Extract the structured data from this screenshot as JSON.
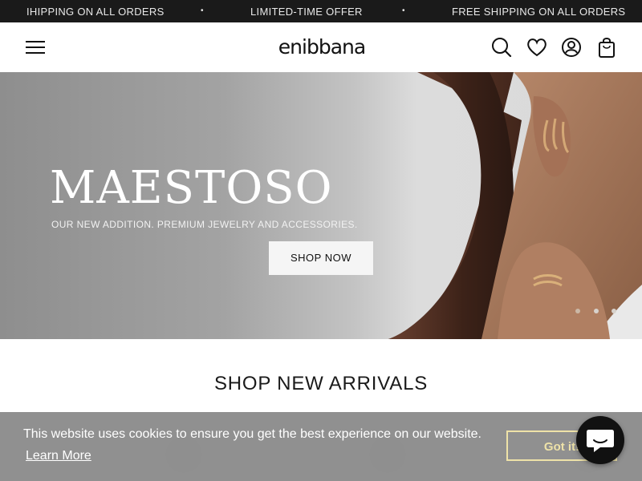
{
  "announcement": {
    "items": [
      "IHIPPING ON ALL ORDERS",
      "LIMITED-TIME OFFER",
      "FREE SHIPPING ON ALL ORDERS"
    ],
    "separator": "•"
  },
  "header": {
    "logo": "enibbana",
    "icons": [
      "menu-icon",
      "search-icon",
      "heart-icon",
      "account-icon",
      "bag-icon"
    ]
  },
  "hero": {
    "title": "MAESTOSO",
    "subtitle": "OUR NEW ADDITION. PREMIUM JEWELRY AND ACCESSORIES.",
    "button": "SHOP NOW",
    "slides": 3,
    "active_slide": 1
  },
  "section": {
    "title": "SHOP NEW ARRIVALS"
  },
  "cookie": {
    "message": "This website uses cookies to ensure you get the best experience on our website.",
    "link": "Learn More",
    "button": "Got it!"
  },
  "colors": {
    "announcement_bg": "#1a1a1a",
    "cookie_accent": "#eee2a8",
    "chat_bg": "#111111"
  }
}
